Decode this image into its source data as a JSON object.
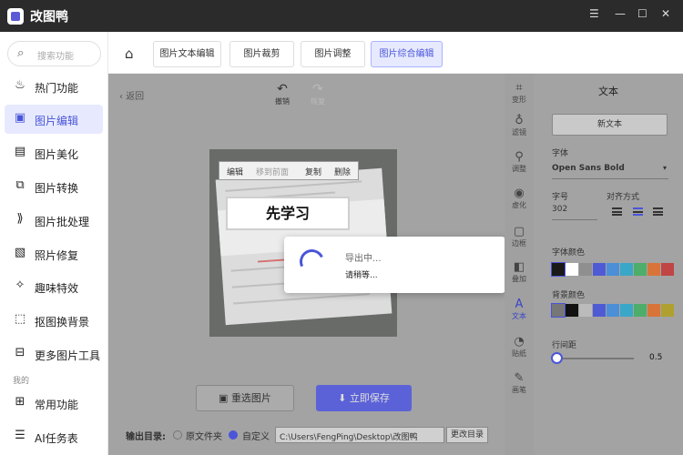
{
  "titlebar": {
    "title": "改图鸭",
    "menu": "☰",
    "min": "—",
    "max": "☐",
    "close": "✕"
  },
  "sidebar": {
    "search_placeholder": "搜索功能",
    "items": [
      {
        "label": "热门功能"
      },
      {
        "label": "图片编辑"
      },
      {
        "label": "图片美化"
      },
      {
        "label": "图片转换"
      },
      {
        "label": "图片批处理"
      },
      {
        "label": "照片修复"
      },
      {
        "label": "趣味特效"
      },
      {
        "label": "抠图换背景"
      },
      {
        "label": "更多图片工具"
      },
      {
        "label": "常用功能"
      },
      {
        "label": "AI任务表"
      }
    ],
    "section_mine": "我的"
  },
  "tabs": [
    {
      "label": "图片文本编辑"
    },
    {
      "label": "图片裁剪"
    },
    {
      "label": "图片调整"
    },
    {
      "label": "图片综合编辑"
    }
  ],
  "workspace": {
    "back": "返回",
    "undo": "撤销",
    "redo": "恢复",
    "context_menu": [
      "编辑",
      "移到前面",
      "复制",
      "删除"
    ],
    "text_box": "先学习",
    "dialog": {
      "line1": "导出中...",
      "line2": "请稍等..."
    },
    "reselect": "重选图片",
    "save": "立即保存",
    "output_label": "输出目录:",
    "option_original": "原文件夹",
    "option_custom": "自定义",
    "path": "C:\\Users\\FengPing\\Desktop\\改图鸭",
    "change_dir": "更改目录"
  },
  "tools": [
    {
      "label": "变形",
      "icon": "crop-icon"
    },
    {
      "label": "滤镜",
      "icon": "filter-icon"
    },
    {
      "label": "调整",
      "icon": "adjust-icon"
    },
    {
      "label": "虚化",
      "icon": "blur-icon"
    },
    {
      "label": "边框",
      "icon": "frame-icon"
    },
    {
      "label": "叠加",
      "icon": "overlay-icon"
    },
    {
      "label": "文本",
      "icon": "text-icon"
    },
    {
      "label": "贴纸",
      "icon": "sticker-icon"
    },
    {
      "label": "画笔",
      "icon": "brush-icon"
    }
  ],
  "panel": {
    "title": "文本",
    "new_text": "新文本",
    "font_label": "字体",
    "font_value": "Open Sans Bold",
    "size_label": "字号",
    "size_value": "302",
    "align_label": "对齐方式",
    "font_color_label": "字体颜色",
    "bg_color_label": "背景颜色",
    "line_spacing_label": "行间距",
    "line_spacing_value": "0.5",
    "font_colors": [
      "#1a1a1a",
      "#ffffff",
      "#8f8f8f",
      "#4f5bd5",
      "#4a8fd8",
      "#39a7c7",
      "#4cae6a",
      "#d8743a",
      "#c04545"
    ],
    "bg_colors": [
      "#777777",
      "#111111",
      "#bbbbbb",
      "#4f5bd5",
      "#4a8fd8",
      "#39a7c7",
      "#4cae6a",
      "#d8743a",
      "#b0a030"
    ]
  }
}
